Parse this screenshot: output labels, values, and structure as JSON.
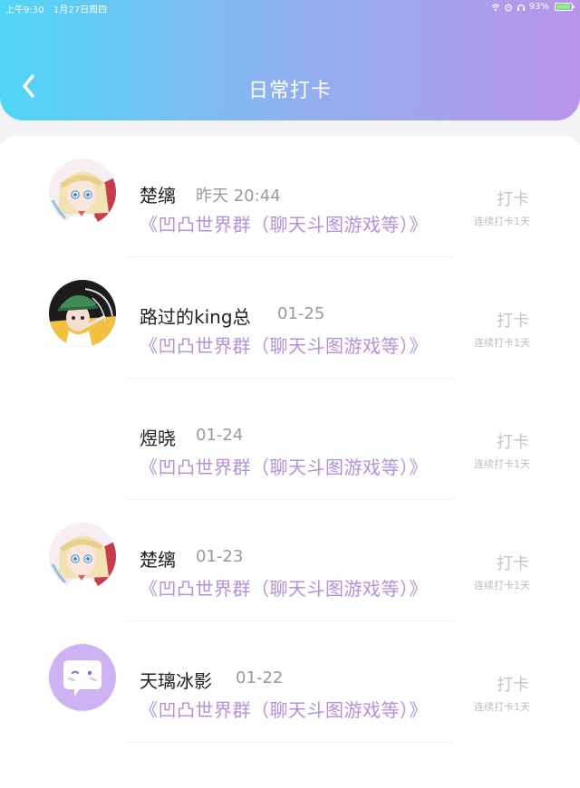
{
  "status_bar": {
    "time": "上午9:30",
    "date": "1月27日周四",
    "battery": "93%",
    "battery_level": 0.93
  },
  "header": {
    "title": "日常打卡",
    "back_icon": "chevron-left-icon"
  },
  "colors": {
    "gradient_start": "#4fd6f7",
    "gradient_end": "#b995ea",
    "group_text": "#b58fe0",
    "checkin_text": "#c4c4c4"
  },
  "records": [
    {
      "name": "楚缡",
      "time": "昨天 20:44",
      "group": "《凹凸世界群（聊天斗图游戏等）》",
      "action": "打卡",
      "streak": "连续打卡1天",
      "avatar": "anime-girl-avatar"
    },
    {
      "name": "路过的king总",
      "time": "01-25",
      "group": "《凹凸世界群（聊天斗图游戏等）》",
      "action": "打卡",
      "streak": "连续打卡1天",
      "avatar": "green-hat-character-avatar"
    },
    {
      "name": "煜晓",
      "time": "01-24",
      "group": "《凹凸世界群（聊天斗图游戏等）》",
      "action": "打卡",
      "streak": "连续打卡1天",
      "avatar": "blank-avatar"
    },
    {
      "name": "楚缡",
      "time": "01-23",
      "group": "《凹凸世界群（聊天斗图游戏等）》",
      "action": "打卡",
      "streak": "连续打卡1天",
      "avatar": "anime-girl-avatar"
    },
    {
      "name": "天璃冰影",
      "time": "01-22",
      "group": "《凹凸世界群（聊天斗图游戏等）》",
      "action": "打卡",
      "streak": "连续打卡1天",
      "avatar": "chat-bubble-avatar"
    }
  ]
}
